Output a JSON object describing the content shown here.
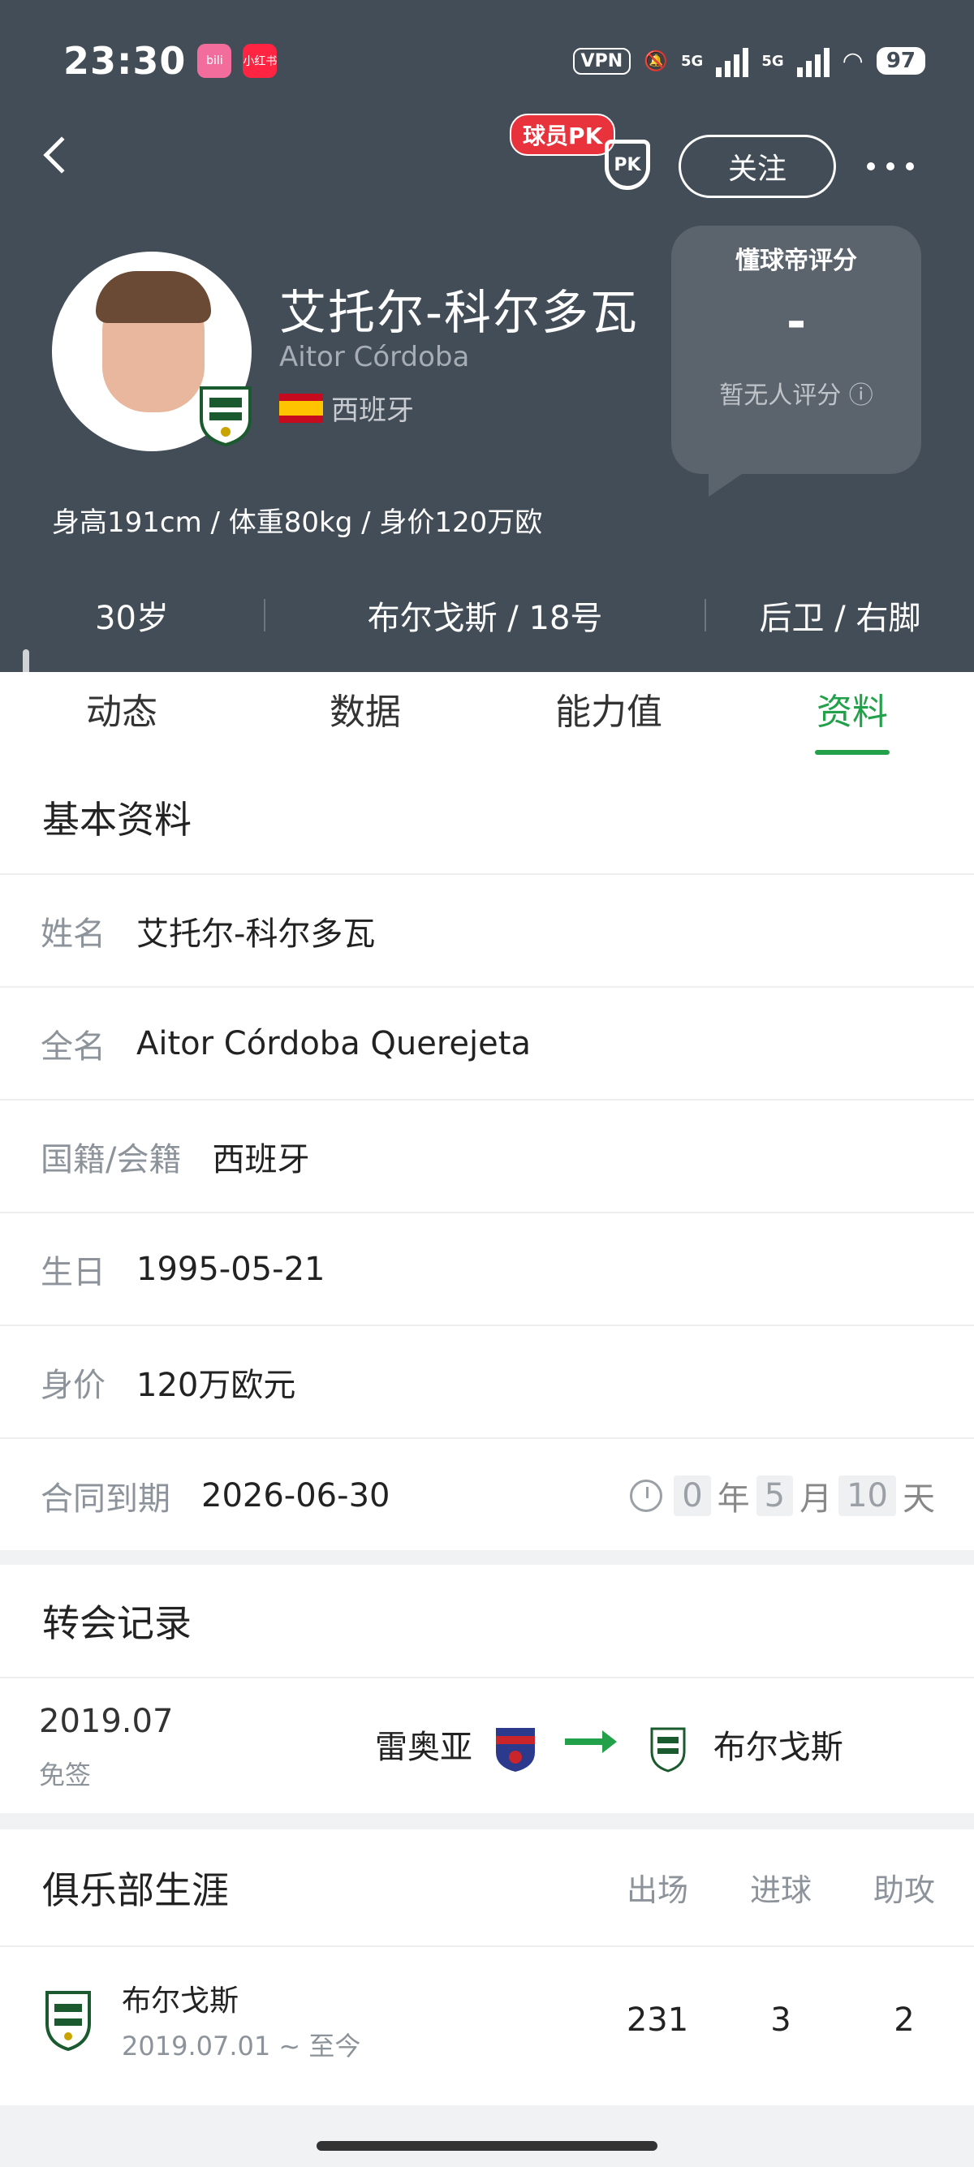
{
  "status_bar": {
    "time": "23:30",
    "app1": "bilibili",
    "app2": "小红书",
    "vpn": "VPN",
    "net1": "5G",
    "net2": "5G",
    "battery": "97"
  },
  "header": {
    "pk_label": "球员PK",
    "pk_icon_text": "PK",
    "follow_label": "关注",
    "name_zh": "艾托尔-科尔多瓦",
    "name_en": "Aitor Córdoba",
    "nationality": "西班牙",
    "rating_title": "懂球帝评分",
    "rating_value": "-",
    "rating_note": "暂无人评分 ⓘ",
    "body_info": "身高191cm / 体重80kg / 身价120万欧",
    "age": "30岁",
    "club_number": "布尔戈斯 / 18号",
    "position_foot": "后卫 / 右脚"
  },
  "tabs": [
    "动态",
    "数据",
    "能力值",
    "资料"
  ],
  "basic_info": {
    "title": "基本资料",
    "rows": [
      {
        "label": "姓名",
        "value": "艾托尔-科尔多瓦"
      },
      {
        "label": "全名",
        "value": "Aitor Córdoba Querejeta"
      },
      {
        "label": "国籍/会籍",
        "value": "西班牙"
      },
      {
        "label": "生日",
        "value": "1995-05-21"
      },
      {
        "label": "身价",
        "value": "120万欧元"
      },
      {
        "label": "合同到期",
        "value": "2026-06-30"
      }
    ],
    "countdown": {
      "years": "0",
      "year_unit": "年",
      "months": "5",
      "month_unit": "月",
      "days": "10",
      "day_unit": "天"
    }
  },
  "transfers": {
    "title": "转会记录",
    "items": [
      {
        "date": "2019.07",
        "type": "免签",
        "from": "雷奥亚",
        "to": "布尔戈斯"
      }
    ]
  },
  "career": {
    "title": "俱乐部生涯",
    "columns": [
      "出场",
      "进球",
      "助攻"
    ],
    "rows": [
      {
        "club": "布尔戈斯",
        "period": "2019.07.01 ~ 至今",
        "apps": "231",
        "goals": "3",
        "assists": "2"
      }
    ]
  },
  "colors": {
    "header_bg": "#434d57",
    "accent_green": "#22a04a",
    "pk_red": "#e8323c"
  }
}
